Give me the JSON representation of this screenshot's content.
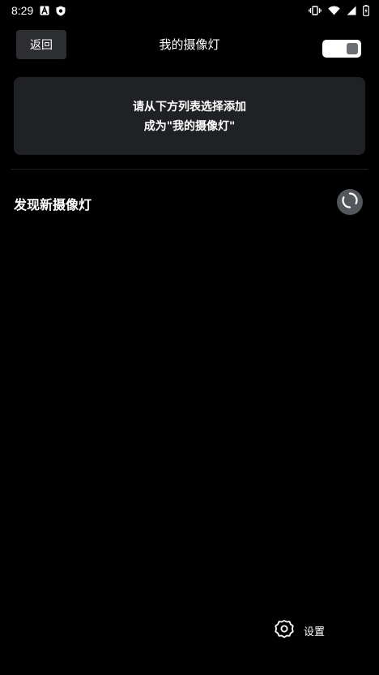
{
  "status_bar": {
    "time": "8:29",
    "left_icons": [
      "text-a-icon",
      "shield-icon"
    ],
    "right_icons": [
      "vibrate-icon",
      "wifi-icon",
      "signal-icon",
      "battery-icon"
    ]
  },
  "header": {
    "back_label": "返回",
    "title": "我的摄像灯",
    "toggle_on": true
  },
  "info_card": {
    "line1": "请从下方列表选择添加",
    "line2": "成为\"我的摄像灯\""
  },
  "section": {
    "title": "发现新摄像灯",
    "refresh_icon": "refresh-icon"
  },
  "settings": {
    "label": "设置",
    "icon": "gear-icon"
  },
  "colors": {
    "background": "#000000",
    "card": "#202124",
    "button": "#2c2e31",
    "refresh_bg": "#53565a"
  }
}
